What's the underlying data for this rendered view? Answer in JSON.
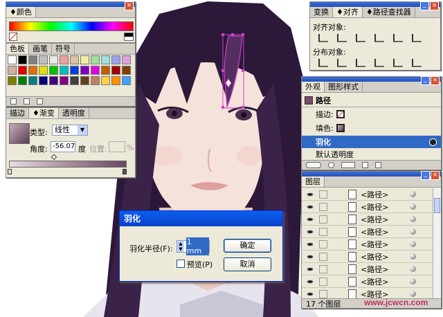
{
  "color_panel": {
    "title": "颜色"
  },
  "swatches_panel": {
    "tabs": [
      "色板",
      "画笔",
      "符号"
    ]
  },
  "gradient_panel": {
    "tabs": [
      "描边",
      "渐变",
      "透明度"
    ],
    "type_label": "类型:",
    "type_value": "线性",
    "angle_label": "角度:",
    "angle_value": "-56.07",
    "angle_unit": "度",
    "location_label": "位置:",
    "location_unit": "%"
  },
  "align_panel": {
    "tabs": [
      "变换",
      "对齐",
      "路径查找器"
    ],
    "align_objects_label": "对齐对象:",
    "distribute_objects_label": "分布对象:"
  },
  "appearance_panel": {
    "tabs": [
      "外观",
      "图形样式"
    ],
    "object_label": "路径",
    "stroke_label": "描边:",
    "fill_label": "填色:",
    "effect_label": "羽化",
    "opacity_label": "默认透明度"
  },
  "layers_panel": {
    "title": "图层",
    "items": [
      "<路径>",
      "<路径>",
      "<路径>",
      "<路径>",
      "<路径>",
      "<路径>",
      "<路径>",
      "<路径>",
      "<路径>"
    ],
    "footer_count": "17 个图层"
  },
  "feather_dialog": {
    "title": "羽化",
    "radius_label": "羽化半径(F):",
    "radius_value": "1 mm",
    "preview_label": "预览(P)",
    "ok_label": "确定",
    "cancel_label": "取消"
  },
  "watermark": "www.jcwcn.com",
  "colors": {
    "accent": "#316ac5",
    "hair": "#2e1a3e",
    "skin": "#f3ded5",
    "selection": "#d040d0"
  }
}
